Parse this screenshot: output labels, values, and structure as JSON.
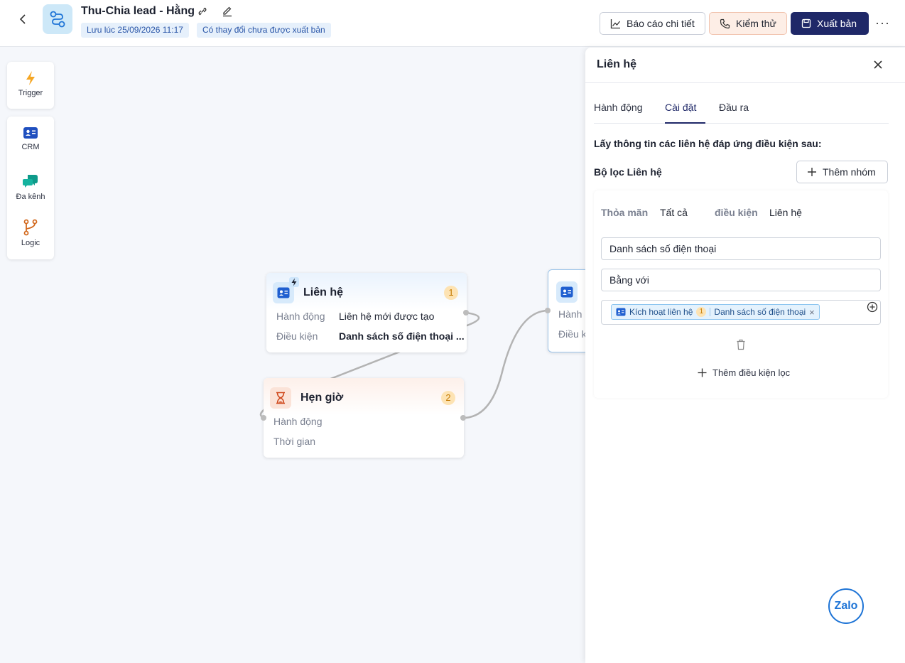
{
  "header": {
    "title": "Thu-Chia lead - Hằng",
    "saved_at": "Lưu lúc 25/09/2026 11:17",
    "unpublished": "Có thay đổi chưa được xuất bản",
    "report_label": "Báo cáo chi tiết",
    "test_label": "Kiểm thử",
    "publish_label": "Xuất bản",
    "more": "···"
  },
  "palette": {
    "trigger": "Trigger",
    "items": [
      "CRM",
      "Đa kênh",
      "Logic"
    ]
  },
  "nodes": {
    "contact": {
      "title": "Liên hệ",
      "badge": "1",
      "action_label": "Hành động",
      "action_value": "Liên hệ mới được tạo",
      "condition_label": "Điều kiện",
      "condition_value": "Danh sách số điện thoại ..."
    },
    "timer": {
      "title": "Hẹn giờ",
      "badge": "2",
      "action_label": "Hành động",
      "time_label": "Thời gian"
    },
    "partial": {
      "action_label": "Hành",
      "condition_label": "Điều k"
    }
  },
  "panel": {
    "title": "Liên hệ",
    "tabs": [
      "Hành động",
      "Cài đặt",
      "Đầu ra"
    ],
    "active_tab": "Cài đặt",
    "heading": "Lấy thông tin các liên hệ đáp ứng điều kiện sau:",
    "filter_label": "Bộ lọc Liên hệ",
    "add_group": "Thêm nhóm",
    "match_label": "Thỏa mãn",
    "match_value": "Tất cả",
    "condition_label": "điều kiện",
    "condition_value": "Liên hệ",
    "field": "Danh sách số điện thoại",
    "operator": "Bằng với",
    "chip": {
      "source": "Kích hoạt liên hệ",
      "num": "1",
      "field": "Danh sách số điện thoại"
    },
    "add_condition": "Thêm điều kiện lọc"
  },
  "floating": {
    "zalo": "Zalo"
  },
  "colors": {
    "primary": "#1f2868",
    "accent_blue": "#1e74d6",
    "badge_bg": "#fde3b3",
    "test_bg": "#fdeee6"
  }
}
